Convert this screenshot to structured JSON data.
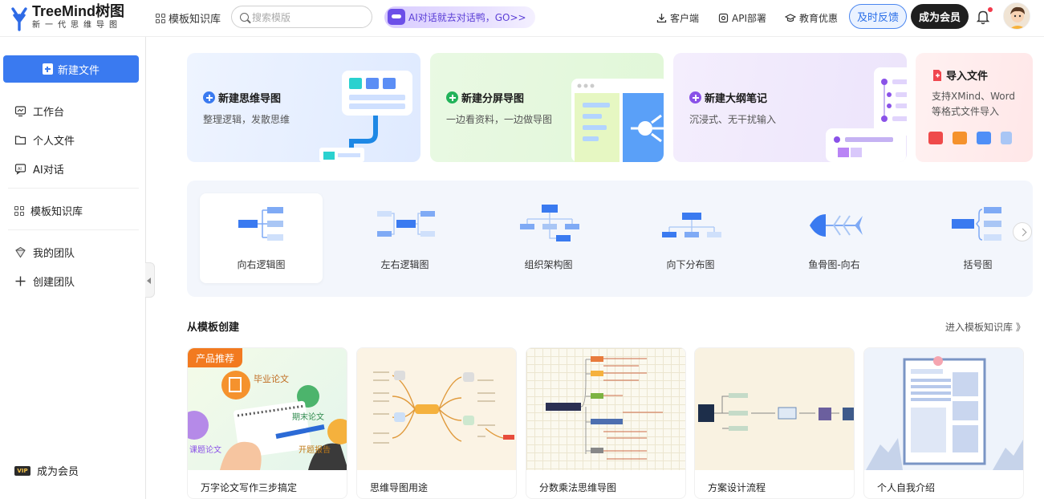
{
  "brand": {
    "title": "TreeMind树图",
    "subtitle": "新一代思维导图"
  },
  "header": {
    "templates_link": "模板知识库",
    "search_placeholder": "搜索模版",
    "ai_banner": "AI对话就去对话鸭，GO>>",
    "client_link": "客户端",
    "api_link": "API部署",
    "edu_link": "教育优惠",
    "feedback_button": "及时反馈",
    "member_button": "成为会员"
  },
  "sidebar": {
    "new_file": "新建文件",
    "items": [
      {
        "label": "工作台",
        "icon": "dashboard-icon"
      },
      {
        "label": "个人文件",
        "icon": "folder-icon"
      },
      {
        "label": "AI对话",
        "icon": "ai-chat-icon"
      },
      {
        "label": "模板知识库",
        "icon": "grid-icon"
      },
      {
        "label": "我的团队",
        "icon": "team-icon"
      },
      {
        "label": "创建团队",
        "icon": "plus-icon"
      }
    ],
    "vip_badge": "VIP",
    "vip_label": "成为会员"
  },
  "cards": [
    {
      "title": "新建思维导图",
      "desc": "整理逻辑，发散思维",
      "accent": "#3a7af0"
    },
    {
      "title": "新建分屏导图",
      "desc": "一边看资料，一边做导图",
      "accent": "#22b35a"
    },
    {
      "title": "新建大纲笔记",
      "desc": "沉浸式、无干扰输入",
      "accent": "#8a52e8"
    },
    {
      "title": "导入文件",
      "desc": "支持XMind、Word等格式文件导入",
      "accent": "#f0474f"
    }
  ],
  "map_types": [
    "向右逻辑图",
    "左右逻辑图",
    "组织架构图",
    "向下分布图",
    "鱼骨图-向右",
    "括号图"
  ],
  "templates": {
    "section_title": "从模板创建",
    "section_link": "进入模板知识库 》",
    "ribbon": "产品推荐",
    "items": [
      "万字论文写作三步搞定",
      "思维导图用途",
      "分数乘法思维导图",
      "方案设计流程",
      "个人自我介绍"
    ],
    "thumb_labels": [
      "毕业论文",
      "期末论文",
      "开题报告",
      "课题论文"
    ]
  },
  "colors": {
    "primary": "#3a7af0",
    "dark": "#1f1f1f",
    "orange": "#f27a20"
  }
}
